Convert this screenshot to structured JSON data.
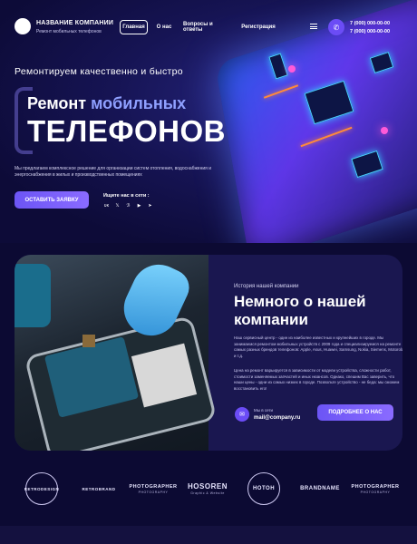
{
  "header": {
    "brand": "НАЗВАНИЕ КОМПАНИИ",
    "brand_sub": "Ремонт мобильных телефонов",
    "nav": [
      {
        "label": "Главная",
        "active": true
      },
      {
        "label": "О нас"
      },
      {
        "label": "Вопросы и ответы"
      },
      {
        "label": "Регистрация"
      }
    ],
    "phones": [
      "7 (000) 000-00-00",
      "7 (000) 000-00-00"
    ],
    "phone_icon": "✆",
    "menu_icon": "hamburger-icon"
  },
  "hero": {
    "tagline": "Ремонтируем качественно и быстро",
    "title_line1_plain": "Ремонт ",
    "title_line1_accent": "мобильных",
    "title_line2": "ТЕЛЕФОНОВ",
    "description": "Мы предлагаем комплексное решение для организации систем отопления, водоснабжения и энергоснабжения в жилых и производственных помещениях",
    "cta_label": "ОСТАВИТЬ ЗАЯВКУ",
    "social_title": "Ищите нас в сети :",
    "socials": [
      "vk-icon",
      "twitter-icon",
      "odnoklassniki-icon",
      "youtube-icon",
      "telegram-icon"
    ],
    "social_glyphs": [
      "ʋκ",
      "𝕏",
      "ℬ",
      "▶",
      "➤"
    ]
  },
  "about": {
    "kicker": "История нашей компании",
    "title": "Немного о нашей компании",
    "paragraph1": "Наш сервисный центр - один из наиболее известных и крупнейших в городе. Мы занимаемся ремонтом мобильных устройств с 2009 года и специализируемся на ремонте самых разных брендов телефонов: Apple, Asus, Huawei, Samsung, Nokia, Siemens, Motorola и т.д.",
    "paragraph2": "Цена на ремонт варьируется в зависимости от модели устройства, сложности работ, стоимости заменяемых запчастей и иных нюансов. Однако, спешим Вас заверить, что наши цены - одни из самых низких в городе. Позвольте устройство - не беда: мы сможем восстановить его!",
    "mail_label": "Мы в сети",
    "mail": "mail@company.ru",
    "more_label": "ПОДРОБНЕЕ О НАС",
    "mail_icon": "✉"
  },
  "logos": [
    {
      "main": "RETRODESIGN",
      "small": "",
      "style": "circle"
    },
    {
      "main": "RETROBRAND",
      "small": "",
      "style": "plain"
    },
    {
      "main": "PHOTOGRAPHER",
      "small": "PHOTOGRAPHY",
      "style": "plain"
    },
    {
      "main": "HOSOREN",
      "small": "Graphic & Website",
      "style": "plain"
    },
    {
      "main": "HOTOH",
      "small": "",
      "style": "circle"
    },
    {
      "main": "BRANDNAME",
      "small": "",
      "style": "plain"
    },
    {
      "main": "PHOTOGRAPHER",
      "small": "PHOTOGRAPHY",
      "style": "plain"
    }
  ],
  "colors": {
    "accent": "#6c55f5",
    "bg": "#0c0a33",
    "card": "#1a1750"
  }
}
